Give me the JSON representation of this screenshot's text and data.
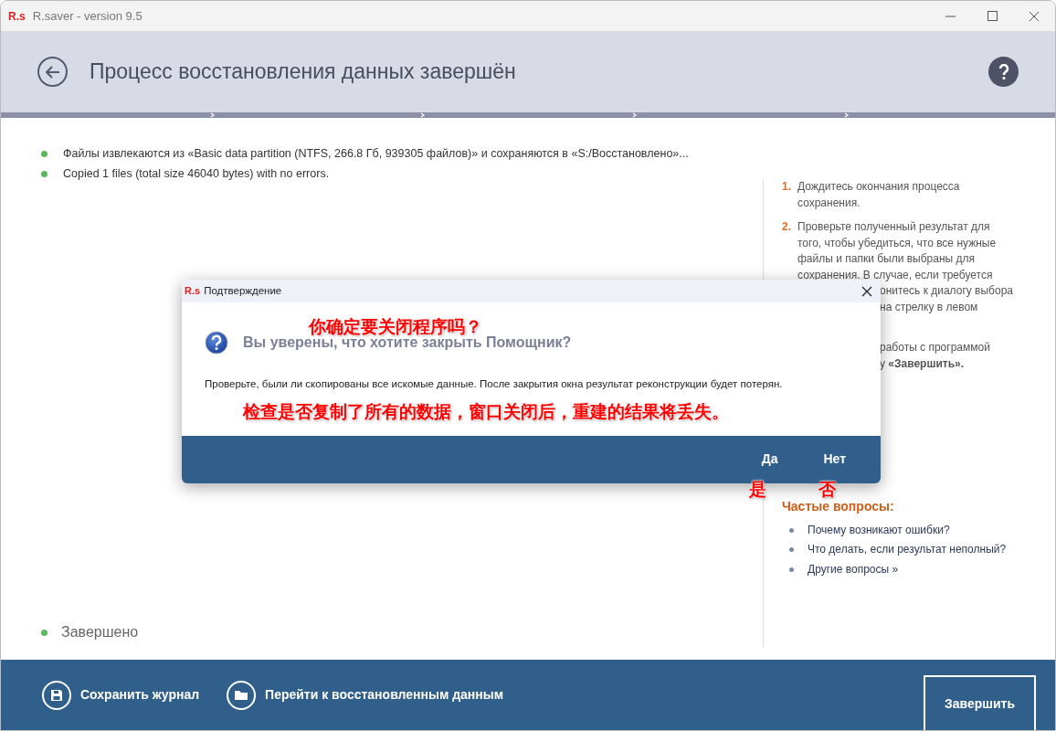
{
  "window": {
    "logo": "R.s",
    "title": "R.saver - version 9.5"
  },
  "header": {
    "title": "Процесс восстановления данных завершён",
    "progress": {
      "level": 1
    }
  },
  "log": [
    "Файлы извлекаются из «Basic data partition (NTFS, 266.8 Гб, 939305 файлов)» и сохраняются в «S:/Восстановлено»...",
    "Copied 1 files (total size 46040 bytes) with no errors."
  ],
  "status": "Завершено",
  "instructions": [
    {
      "number": "1.",
      "lines": [
        {
          "kind": "full",
          "text": "Дождитесь окончания процесса"
        },
        {
          "kind": "full",
          "text": "сохранения."
        }
      ]
    },
    {
      "number": "2.",
      "lines": [
        {
          "kind": "full",
          "text": "Проверьте полученный результат для"
        },
        {
          "kind": "full",
          "text": "того, чтобы убедиться, что все нужные"
        },
        {
          "kind": "full",
          "text": "файлы и папки были выбраны для"
        },
        {
          "kind": "full",
          "text": "сохранения. В случае, если требуется"
        },
        {
          "kind": "cut",
          "text": "онитесь к диалогу выбора"
        },
        {
          "kind": "cut",
          "text": "на стрелку в левом"
        }
      ]
    },
    {
      "lines": [
        {
          "kind": "gap"
        },
        {
          "kind": "cut",
          "text": "работы с программой"
        },
        {
          "kind": "cut",
          "text": "у **«Завершить».**"
        }
      ]
    }
  ],
  "faq": {
    "title": "Частые вопросы:",
    "items": [
      "Почему возникают ошибки?",
      "Что делать, если результат неполный?",
      "Другие вопросы »"
    ]
  },
  "footer": {
    "buttons": [
      {
        "kind": "save",
        "label": "Сохранить журнал"
      },
      {
        "kind": "folder",
        "label": "Перейти к восстановленным данным"
      }
    ],
    "finish": "Завершить"
  },
  "dialog": {
    "logo": "R.s",
    "title": "Подтверждение",
    "question": "Вы уверены, что хотите закрыть Помощник?",
    "message": "Проверьте, были ли скопированы все искомые данные. После закрытия окна результат реконструкции будет потерян.",
    "buttons": [
      "Да",
      "Нет"
    ]
  },
  "annotations": [
    "你确定要关闭程序吗？",
    "检查是否复制了所有的数据，窗口关闭后，重建的结果将丢失。",
    "是",
    "否"
  ]
}
